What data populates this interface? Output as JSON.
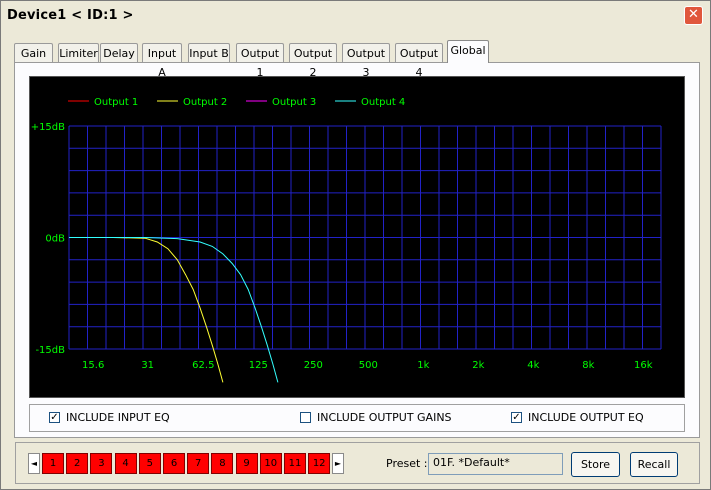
{
  "window": {
    "title": "Device1 < ID:1 >",
    "close_glyph": "✕",
    "close_icon": "close-icon"
  },
  "tabs": [
    {
      "label": "Gain"
    },
    {
      "label": "Limiter"
    },
    {
      "label": "Delay"
    },
    {
      "label": "Input A"
    },
    {
      "label": "Input B"
    },
    {
      "label": "Output 1"
    },
    {
      "label": "Output 2"
    },
    {
      "label": "Output 3"
    },
    {
      "label": "Output 4"
    },
    {
      "label": "Global",
      "active": true
    }
  ],
  "chart_data": {
    "type": "line",
    "x_scale": "log",
    "xlim": [
      11.5,
      20000
    ],
    "ylim": [
      -15,
      15
    ],
    "y_ticks": [
      "+15dB",
      "0dB",
      "-15dB"
    ],
    "x_ticks": [
      {
        "value": 15.6,
        "label": "15.6"
      },
      {
        "value": 31,
        "label": "31"
      },
      {
        "value": 62.5,
        "label": "62.5"
      },
      {
        "value": 125,
        "label": "125"
      },
      {
        "value": 250,
        "label": "250"
      },
      {
        "value": 500,
        "label": "500"
      },
      {
        "value": 1000,
        "label": "1k"
      },
      {
        "value": 2000,
        "label": "2k"
      },
      {
        "value": 4000,
        "label": "4k"
      },
      {
        "value": 8000,
        "label": "8k"
      },
      {
        "value": 16000,
        "label": "16k"
      }
    ],
    "grid": true,
    "legend_position": "top",
    "colors": {
      "background": "#000000",
      "grid": "#2222c8",
      "text": "#00ff00"
    },
    "series": [
      {
        "name": "Output 1",
        "color": "#ff0000",
        "points": []
      },
      {
        "name": "Output 2",
        "color": "#ffff33",
        "points": [
          [
            11.5,
            0
          ],
          [
            20,
            0
          ],
          [
            30,
            -0.1
          ],
          [
            35,
            -0.6
          ],
          [
            40,
            -1.5
          ],
          [
            45,
            -3
          ],
          [
            50,
            -5
          ],
          [
            55,
            -7
          ],
          [
            60,
            -9.5
          ],
          [
            65,
            -12
          ],
          [
            70,
            -14.5
          ],
          [
            75,
            -17
          ],
          [
            80,
            -19.5
          ]
        ]
      },
      {
        "name": "Output 3",
        "color": "#ff00ff",
        "points": []
      },
      {
        "name": "Output 4",
        "color": "#33ffff",
        "points": [
          [
            11.5,
            0
          ],
          [
            30,
            0
          ],
          [
            45,
            -0.15
          ],
          [
            60,
            -0.6
          ],
          [
            70,
            -1.2
          ],
          [
            80,
            -2.2
          ],
          [
            90,
            -3.5
          ],
          [
            100,
            -5
          ],
          [
            110,
            -7
          ],
          [
            120,
            -9.5
          ],
          [
            130,
            -12
          ],
          [
            140,
            -14.5
          ],
          [
            150,
            -17
          ],
          [
            160,
            -19.5
          ]
        ]
      }
    ]
  },
  "options": {
    "include_input_eq": {
      "label": "INCLUDE INPUT EQ",
      "checked": true
    },
    "include_output_gains": {
      "label": "INCLUDE OUTPUT GAINS",
      "checked": false
    },
    "include_output_eq": {
      "label": "INCLUDE OUTPUT EQ",
      "checked": true
    }
  },
  "preset_slots": [
    "1",
    "2",
    "3",
    "4",
    "5",
    "6",
    "7",
    "8",
    "9",
    "10",
    "11",
    "12"
  ],
  "preset": {
    "label": "Preset :",
    "value": "01F. *Default*"
  },
  "buttons": {
    "store": "Store",
    "recall": "Recall",
    "prev_glyph": "◄",
    "next_glyph": "►"
  }
}
